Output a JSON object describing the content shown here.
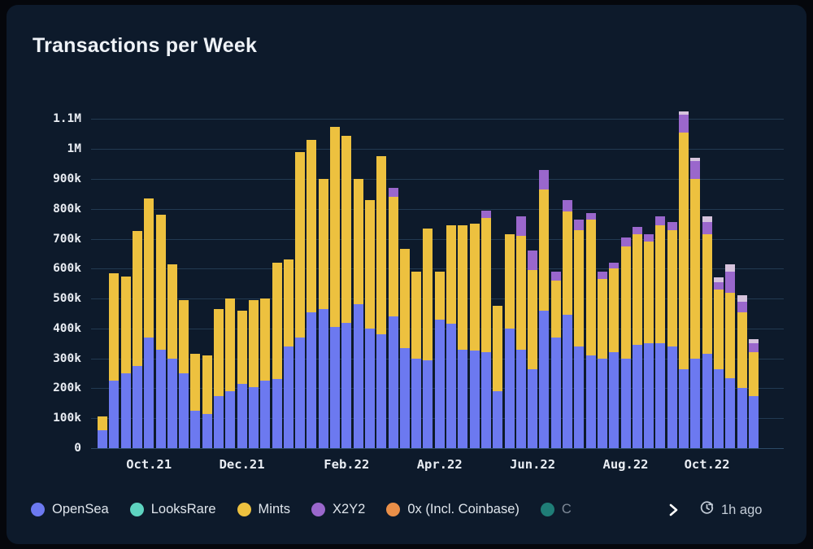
{
  "card": {
    "title": "Transactions per Week",
    "background": "#0d1a2b"
  },
  "legend": {
    "items": [
      {
        "label": "OpenSea",
        "color": "#6c79f0"
      },
      {
        "label": "LooksRare",
        "color": "#5ed3c0"
      },
      {
        "label": "Mints",
        "color": "#edc13f"
      },
      {
        "label": "X2Y2",
        "color": "#9a67cc"
      },
      {
        "label": "0x (Incl. Coinbase)",
        "color": "#ea8f48"
      },
      {
        "label": "C",
        "color": "#1f7d77"
      }
    ],
    "scroll_next_icon": "chevron-right-icon",
    "refresh_icon": "clock-refresh-icon",
    "updated_label": "1h ago"
  },
  "chart_data": {
    "type": "bar",
    "stacked": true,
    "title": "Transactions per Week",
    "xlabel": "",
    "ylabel": "",
    "ylim": [
      0,
      1150000
    ],
    "grid": true,
    "legend_position": "bottom",
    "ytick_labels": [
      "0",
      "100k",
      "200k",
      "300k",
      "400k",
      "500k",
      "600k",
      "700k",
      "800k",
      "900k",
      "1M",
      "1.1M"
    ],
    "ytick_values": [
      0,
      100000,
      200000,
      300000,
      400000,
      500000,
      600000,
      700000,
      800000,
      900000,
      1000000,
      1100000
    ],
    "xtick_labels": [
      "Oct.21",
      "Dec.21",
      "Feb.22",
      "Apr.22",
      "Jun.22",
      "Aug.22",
      "Oct.22"
    ],
    "xtick_indices": [
      4,
      12,
      21,
      29,
      37,
      45,
      52
    ],
    "series": [
      {
        "name": "OpenSea",
        "color": "#6c79f0",
        "values": [
          60000,
          225000,
          250000,
          275000,
          370000,
          330000,
          300000,
          250000,
          125000,
          115000,
          175000,
          190000,
          215000,
          205000,
          225000,
          230000,
          340000,
          370000,
          455000,
          465000,
          405000,
          420000,
          480000,
          400000,
          380000,
          440000,
          335000,
          300000,
          295000,
          430000,
          415000,
          330000,
          325000,
          320000,
          190000,
          400000,
          330000,
          265000,
          460000,
          370000,
          445000,
          340000,
          310000,
          300000,
          320000,
          300000,
          345000,
          350000,
          350000,
          340000,
          265000,
          300000,
          315000,
          265000,
          235000,
          200000,
          175000
        ]
      },
      {
        "name": "LooksRare",
        "color": "#5ed3c0",
        "values": [
          0,
          0,
          0,
          0,
          0,
          0,
          0,
          0,
          0,
          0,
          0,
          0,
          0,
          0,
          0,
          0,
          0,
          0,
          0,
          0,
          0,
          0,
          0,
          0,
          0,
          0,
          0,
          0,
          0,
          0,
          0,
          0,
          0,
          0,
          0,
          0,
          0,
          0,
          0,
          0,
          0,
          0,
          0,
          0,
          0,
          0,
          0,
          0,
          0,
          0,
          0,
          0,
          0,
          0,
          0,
          0,
          0
        ]
      },
      {
        "name": "Mints",
        "color": "#edc13f",
        "values": [
          45000,
          360000,
          325000,
          450000,
          465000,
          450000,
          315000,
          245000,
          190000,
          195000,
          290000,
          310000,
          245000,
          290000,
          275000,
          390000,
          290000,
          620000,
          575000,
          435000,
          670000,
          625000,
          420000,
          430000,
          595000,
          400000,
          330000,
          290000,
          440000,
          160000,
          330000,
          415000,
          425000,
          450000,
          285000,
          315000,
          380000,
          330000,
          405000,
          190000,
          345000,
          390000,
          455000,
          265000,
          280000,
          375000,
          370000,
          340000,
          395000,
          390000,
          790000,
          600000,
          400000,
          265000,
          285000,
          255000,
          145000
        ]
      },
      {
        "name": "X2Y2",
        "color": "#9a67cc",
        "values": [
          0,
          0,
          0,
          0,
          0,
          0,
          0,
          0,
          0,
          0,
          0,
          0,
          0,
          0,
          0,
          0,
          0,
          0,
          0,
          0,
          0,
          0,
          0,
          0,
          0,
          30000,
          0,
          0,
          0,
          0,
          0,
          0,
          0,
          25000,
          0,
          0,
          65000,
          65000,
          65000,
          30000,
          40000,
          35000,
          20000,
          25000,
          20000,
          30000,
          25000,
          25000,
          30000,
          25000,
          60000,
          60000,
          40000,
          25000,
          70000,
          35000,
          30000
        ]
      },
      {
        "name": "0x (Incl. Coinbase)",
        "color": "#ea8f48",
        "values": [
          0,
          0,
          0,
          0,
          0,
          0,
          0,
          0,
          0,
          0,
          0,
          0,
          0,
          0,
          0,
          0,
          0,
          0,
          0,
          0,
          0,
          0,
          0,
          0,
          0,
          0,
          0,
          0,
          0,
          0,
          0,
          0,
          0,
          0,
          0,
          0,
          0,
          0,
          0,
          0,
          0,
          0,
          0,
          0,
          0,
          0,
          0,
          0,
          0,
          0,
          0,
          0,
          0,
          0,
          0,
          0,
          0
        ]
      },
      {
        "name": "C",
        "color": "#d6c3dd",
        "values": [
          0,
          0,
          0,
          0,
          0,
          0,
          0,
          0,
          0,
          0,
          0,
          0,
          0,
          0,
          0,
          0,
          0,
          0,
          0,
          0,
          0,
          0,
          0,
          0,
          0,
          0,
          0,
          0,
          0,
          0,
          0,
          0,
          0,
          0,
          0,
          0,
          0,
          0,
          0,
          0,
          0,
          0,
          0,
          0,
          0,
          0,
          0,
          0,
          0,
          0,
          10000,
          10000,
          20000,
          15000,
          25000,
          20000,
          15000
        ]
      }
    ]
  }
}
